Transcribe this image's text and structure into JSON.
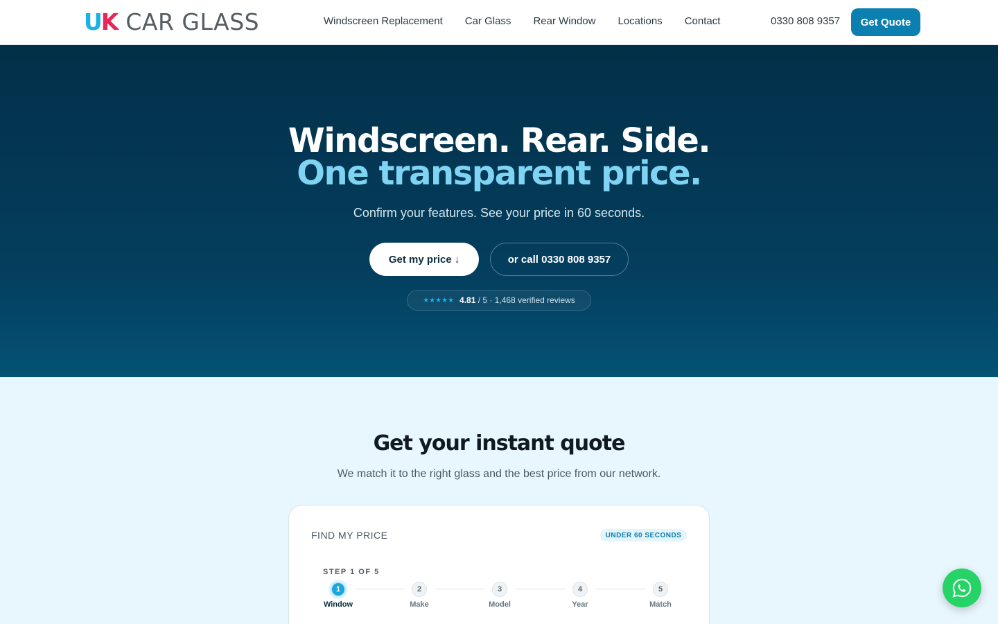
{
  "brand": {
    "logo_u": "U",
    "logo_k": "K",
    "name": "CAR GLASS"
  },
  "nav": {
    "items": [
      "Windscreen Replacement",
      "Car Glass",
      "Rear Window",
      "Locations",
      "Contact"
    ]
  },
  "header": {
    "phone": "0330 808 9357",
    "cta": "Get Quote"
  },
  "hero": {
    "headline_1": "Windscreen. Rear. Side.",
    "headline_2": "One transparent price.",
    "subtitle": "Confirm your features. See your price in 60 seconds.",
    "primary_btn": "Get my price",
    "primary_icon": "↓",
    "secondary_btn": "or call 0330 808 9357",
    "rating_stars": "★★★★★",
    "rating_value": "4.81",
    "rating_text": "/ 5 · 1,468 verified reviews"
  },
  "quote": {
    "title": "Get your instant quote",
    "subtitle": "We match it to the right glass and the best price from our network.",
    "card_label": "FIND MY PRICE",
    "badge": "UNDER 60 SECONDS",
    "step_label": "STEP 1 OF 5",
    "steps": [
      {
        "num": "1",
        "name": "Window"
      },
      {
        "num": "2",
        "name": "Make"
      },
      {
        "num": "3",
        "name": "Model"
      },
      {
        "num": "4",
        "name": "Year"
      },
      {
        "num": "5",
        "name": "Match"
      }
    ]
  },
  "colors": {
    "brand_blue": "#0a7fb0",
    "accent_cyan": "#1cb0e6",
    "accent_pink": "#e8265a",
    "whatsapp": "#25d366"
  },
  "icons": {
    "whatsapp": "whatsapp-icon",
    "arrow": "arrow-down-icon"
  }
}
